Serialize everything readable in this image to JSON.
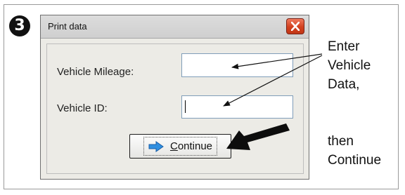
{
  "step": {
    "badge": "3"
  },
  "dialog": {
    "title": "Print data",
    "close_icon": "close-x-icon",
    "fields": [
      {
        "label": "Vehicle Mileage:",
        "value": ""
      },
      {
        "label": "Vehicle ID:",
        "value": ""
      }
    ],
    "continue_button": {
      "icon": "arrow-right-icon",
      "underlined_letter": "C",
      "rest": "ontinue"
    }
  },
  "annotation": {
    "lines": [
      "Enter",
      "Vehicle",
      "Data,",
      "then",
      "Continue"
    ]
  },
  "colors": {
    "close_button": "#d2401f",
    "arrow_icon": "#2f8fe0",
    "titlebar": "#d6d6d6",
    "dialog_bg": "#ecebe6"
  }
}
